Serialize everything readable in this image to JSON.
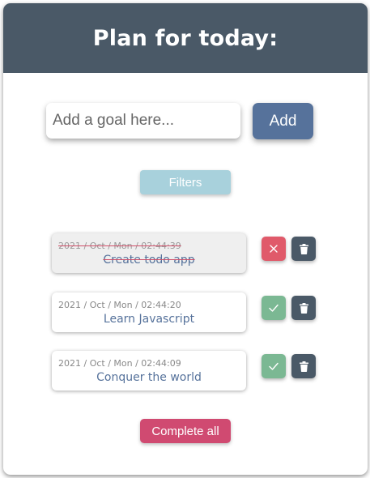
{
  "header": {
    "title": "Plan for today:"
  },
  "form": {
    "placeholder": "Add a goal here...",
    "value": "",
    "add_label": "Add"
  },
  "filters": {
    "label": "Filters"
  },
  "todos": [
    {
      "date": "2021 / Oct / Mon / 02:44:39",
      "text": "Create todo app",
      "completed": true
    },
    {
      "date": "2021 / Oct / Mon / 02:44:20",
      "text": "Learn Javascript",
      "completed": false
    },
    {
      "date": "2021 / Oct / Mon / 02:44:09",
      "text": "Conquer the world",
      "completed": false
    }
  ],
  "footer": {
    "complete_all_label": "Complete all"
  },
  "colors": {
    "header_bg": "#4a5967",
    "primary": "#56729b",
    "filters_bg": "#a8d1dc",
    "undo": "#e05a6a",
    "check": "#7bb893",
    "danger": "#d04a71"
  },
  "icons": {
    "undo": "close-icon",
    "check": "check-icon",
    "trash": "trash-icon"
  }
}
